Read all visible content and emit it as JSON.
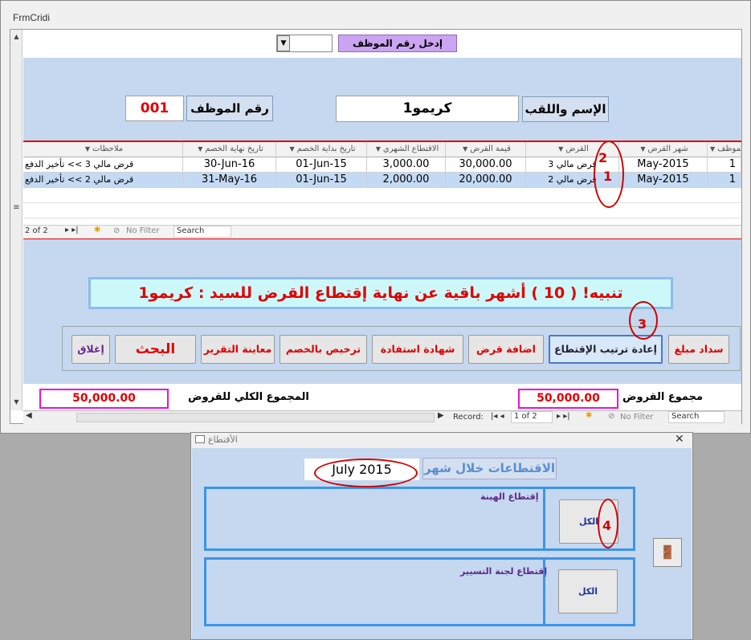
{
  "main": {
    "title": "FrmCridi",
    "search_label": "إدخل رقم الموظف",
    "name_label": "الإسم واللقب",
    "name_value": "كريمو1",
    "empno_label": "رقم الموظف",
    "empno_value": "001"
  },
  "grid": {
    "headers": [
      "رقم الموظف",
      "شهر القرض",
      "القرض",
      "قيمة القرض",
      "الاقتطاع الشهري",
      "تاريخ بداية الخصم",
      "تاريخ نهاية الخصم",
      "ملاحظات"
    ],
    "rows": [
      {
        "emp": "1",
        "month": "May-2015",
        "loan": "قرض مالي 3",
        "amount": "30,000.00",
        "monthly": "3,000.00",
        "start": "01-Jun-15",
        "end": "30-Jun-16",
        "notes": "قرض مالي 3 >> تأخير الدفع"
      },
      {
        "emp": "1",
        "month": "May-2015",
        "loan": "قرض مالي 2",
        "amount": "20,000.00",
        "monthly": "2,000.00",
        "start": "01-Jun-15",
        "end": "31-May-16",
        "notes": "قرض مالي 2 >> تأخير الدفع"
      }
    ],
    "nav_record": "2 of 2",
    "nav_filter": "No Filter",
    "nav_search": "Search"
  },
  "warning": "تنبيه! ( 10 ) أشهر باقية عن نهاية إقتطاع القرض للسيد : كريمو1",
  "buttons": {
    "pay": "سداد مبلغ",
    "reorder": "إعادة ترتيب الإقتطاع",
    "add_loan": "اضافة قرض",
    "certificate": "شهادة استفادة",
    "authorization": "ترخيص بالخصم",
    "preview": "معاينة التقرير",
    "search": "البحث",
    "close": "إغلاق"
  },
  "totals": {
    "loans_label": "مجموع القروض",
    "loans_value": "50,000.00",
    "total_label": "المجموع الكلي للقروض",
    "total_value": "50,000.00"
  },
  "nav": {
    "record_label": "Record:",
    "record_value": "1 of 2",
    "filter": "No Filter",
    "search": "Search"
  },
  "dialog": {
    "title": "الأقتطاع",
    "month_label": "الاقتطاعات خلال شهر",
    "month_value": "July  2015",
    "group1_title": "إقتطاع الهينة",
    "group2_title": "إقتطاع لجنة التسيير",
    "all_label": "الكل"
  },
  "annotations": [
    "1",
    "2",
    "3",
    "4"
  ],
  "colors": {
    "accent_red": "#e00000",
    "band_blue": "#c5d8f0",
    "pink": "#e810d8",
    "group_blue": "#3b95e8"
  }
}
